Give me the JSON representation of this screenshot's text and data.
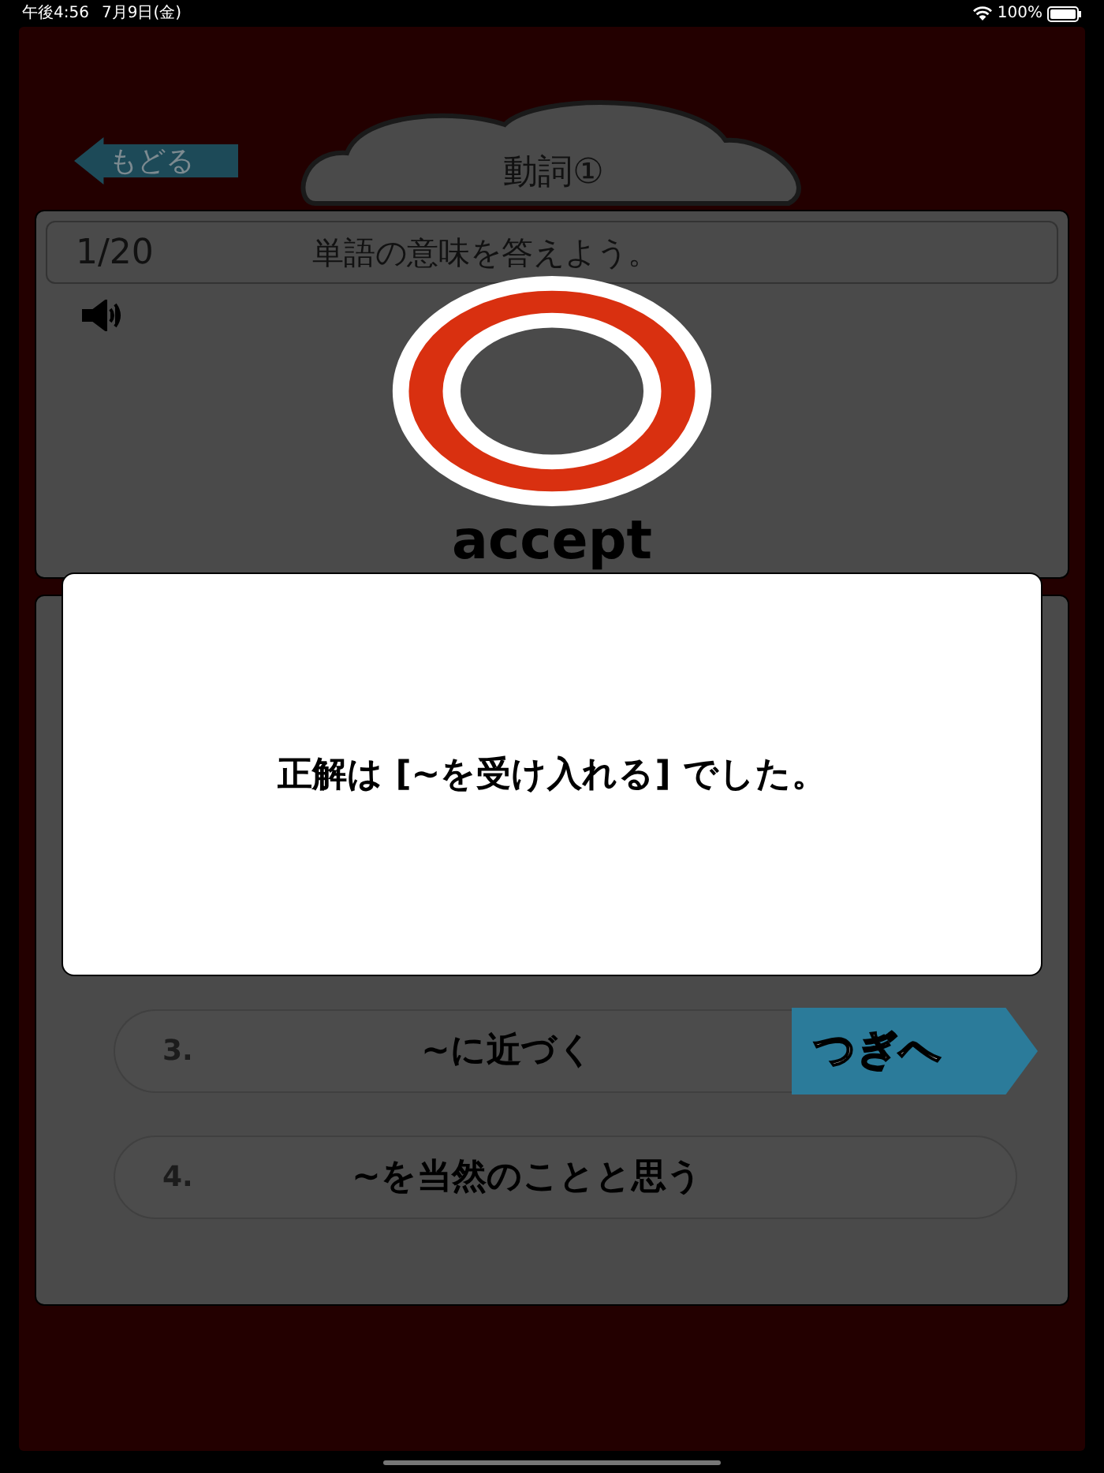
{
  "status_bar": {
    "time": "午後4:56",
    "date": "7月9日(金)",
    "battery": "100%"
  },
  "back_button": {
    "label": "もどる"
  },
  "title": "動詞①",
  "question": {
    "counter": "1/20",
    "instruction": "単語の意味を答えよう。",
    "word": "accept"
  },
  "result": {
    "kind": "correct"
  },
  "options": [
    {
      "number": "3.",
      "text": "~に近づく"
    },
    {
      "number": "4.",
      "text": "~を当然のことと思う"
    }
  ],
  "dialog": {
    "message": "正解は [~を受け入れる] でした。"
  },
  "next_button": {
    "label": "つぎへ"
  }
}
